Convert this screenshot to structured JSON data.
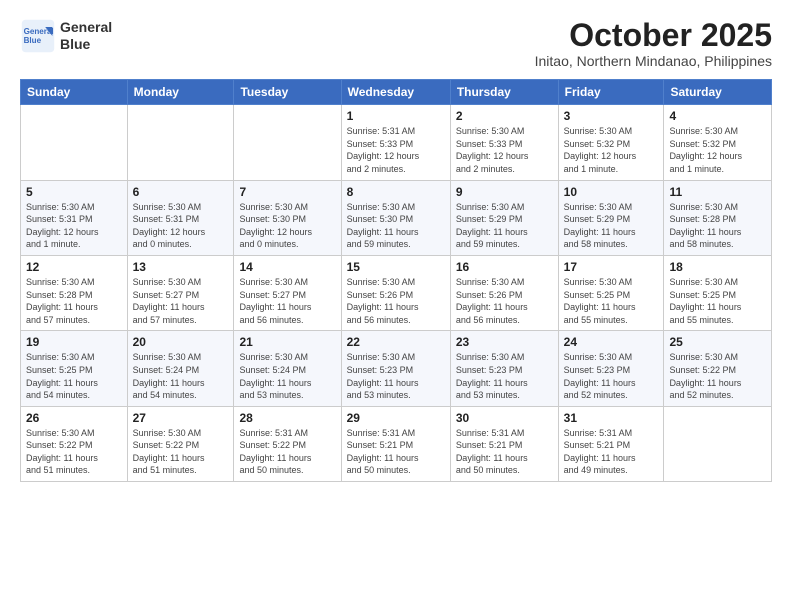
{
  "header": {
    "logo_line1": "General",
    "logo_line2": "Blue",
    "month": "October 2025",
    "location": "Initao, Northern Mindanao, Philippines"
  },
  "weekdays": [
    "Sunday",
    "Monday",
    "Tuesday",
    "Wednesday",
    "Thursday",
    "Friday",
    "Saturday"
  ],
  "weeks": [
    [
      {
        "day": "",
        "info": ""
      },
      {
        "day": "",
        "info": ""
      },
      {
        "day": "",
        "info": ""
      },
      {
        "day": "1",
        "info": "Sunrise: 5:31 AM\nSunset: 5:33 PM\nDaylight: 12 hours\nand 2 minutes."
      },
      {
        "day": "2",
        "info": "Sunrise: 5:30 AM\nSunset: 5:33 PM\nDaylight: 12 hours\nand 2 minutes."
      },
      {
        "day": "3",
        "info": "Sunrise: 5:30 AM\nSunset: 5:32 PM\nDaylight: 12 hours\nand 1 minute."
      },
      {
        "day": "4",
        "info": "Sunrise: 5:30 AM\nSunset: 5:32 PM\nDaylight: 12 hours\nand 1 minute."
      }
    ],
    [
      {
        "day": "5",
        "info": "Sunrise: 5:30 AM\nSunset: 5:31 PM\nDaylight: 12 hours\nand 1 minute."
      },
      {
        "day": "6",
        "info": "Sunrise: 5:30 AM\nSunset: 5:31 PM\nDaylight: 12 hours\nand 0 minutes."
      },
      {
        "day": "7",
        "info": "Sunrise: 5:30 AM\nSunset: 5:30 PM\nDaylight: 12 hours\nand 0 minutes."
      },
      {
        "day": "8",
        "info": "Sunrise: 5:30 AM\nSunset: 5:30 PM\nDaylight: 11 hours\nand 59 minutes."
      },
      {
        "day": "9",
        "info": "Sunrise: 5:30 AM\nSunset: 5:29 PM\nDaylight: 11 hours\nand 59 minutes."
      },
      {
        "day": "10",
        "info": "Sunrise: 5:30 AM\nSunset: 5:29 PM\nDaylight: 11 hours\nand 58 minutes."
      },
      {
        "day": "11",
        "info": "Sunrise: 5:30 AM\nSunset: 5:28 PM\nDaylight: 11 hours\nand 58 minutes."
      }
    ],
    [
      {
        "day": "12",
        "info": "Sunrise: 5:30 AM\nSunset: 5:28 PM\nDaylight: 11 hours\nand 57 minutes."
      },
      {
        "day": "13",
        "info": "Sunrise: 5:30 AM\nSunset: 5:27 PM\nDaylight: 11 hours\nand 57 minutes."
      },
      {
        "day": "14",
        "info": "Sunrise: 5:30 AM\nSunset: 5:27 PM\nDaylight: 11 hours\nand 56 minutes."
      },
      {
        "day": "15",
        "info": "Sunrise: 5:30 AM\nSunset: 5:26 PM\nDaylight: 11 hours\nand 56 minutes."
      },
      {
        "day": "16",
        "info": "Sunrise: 5:30 AM\nSunset: 5:26 PM\nDaylight: 11 hours\nand 56 minutes."
      },
      {
        "day": "17",
        "info": "Sunrise: 5:30 AM\nSunset: 5:25 PM\nDaylight: 11 hours\nand 55 minutes."
      },
      {
        "day": "18",
        "info": "Sunrise: 5:30 AM\nSunset: 5:25 PM\nDaylight: 11 hours\nand 55 minutes."
      }
    ],
    [
      {
        "day": "19",
        "info": "Sunrise: 5:30 AM\nSunset: 5:25 PM\nDaylight: 11 hours\nand 54 minutes."
      },
      {
        "day": "20",
        "info": "Sunrise: 5:30 AM\nSunset: 5:24 PM\nDaylight: 11 hours\nand 54 minutes."
      },
      {
        "day": "21",
        "info": "Sunrise: 5:30 AM\nSunset: 5:24 PM\nDaylight: 11 hours\nand 53 minutes."
      },
      {
        "day": "22",
        "info": "Sunrise: 5:30 AM\nSunset: 5:23 PM\nDaylight: 11 hours\nand 53 minutes."
      },
      {
        "day": "23",
        "info": "Sunrise: 5:30 AM\nSunset: 5:23 PM\nDaylight: 11 hours\nand 53 minutes."
      },
      {
        "day": "24",
        "info": "Sunrise: 5:30 AM\nSunset: 5:23 PM\nDaylight: 11 hours\nand 52 minutes."
      },
      {
        "day": "25",
        "info": "Sunrise: 5:30 AM\nSunset: 5:22 PM\nDaylight: 11 hours\nand 52 minutes."
      }
    ],
    [
      {
        "day": "26",
        "info": "Sunrise: 5:30 AM\nSunset: 5:22 PM\nDaylight: 11 hours\nand 51 minutes."
      },
      {
        "day": "27",
        "info": "Sunrise: 5:30 AM\nSunset: 5:22 PM\nDaylight: 11 hours\nand 51 minutes."
      },
      {
        "day": "28",
        "info": "Sunrise: 5:31 AM\nSunset: 5:22 PM\nDaylight: 11 hours\nand 50 minutes."
      },
      {
        "day": "29",
        "info": "Sunrise: 5:31 AM\nSunset: 5:21 PM\nDaylight: 11 hours\nand 50 minutes."
      },
      {
        "day": "30",
        "info": "Sunrise: 5:31 AM\nSunset: 5:21 PM\nDaylight: 11 hours\nand 50 minutes."
      },
      {
        "day": "31",
        "info": "Sunrise: 5:31 AM\nSunset: 5:21 PM\nDaylight: 11 hours\nand 49 minutes."
      },
      {
        "day": "",
        "info": ""
      }
    ]
  ]
}
